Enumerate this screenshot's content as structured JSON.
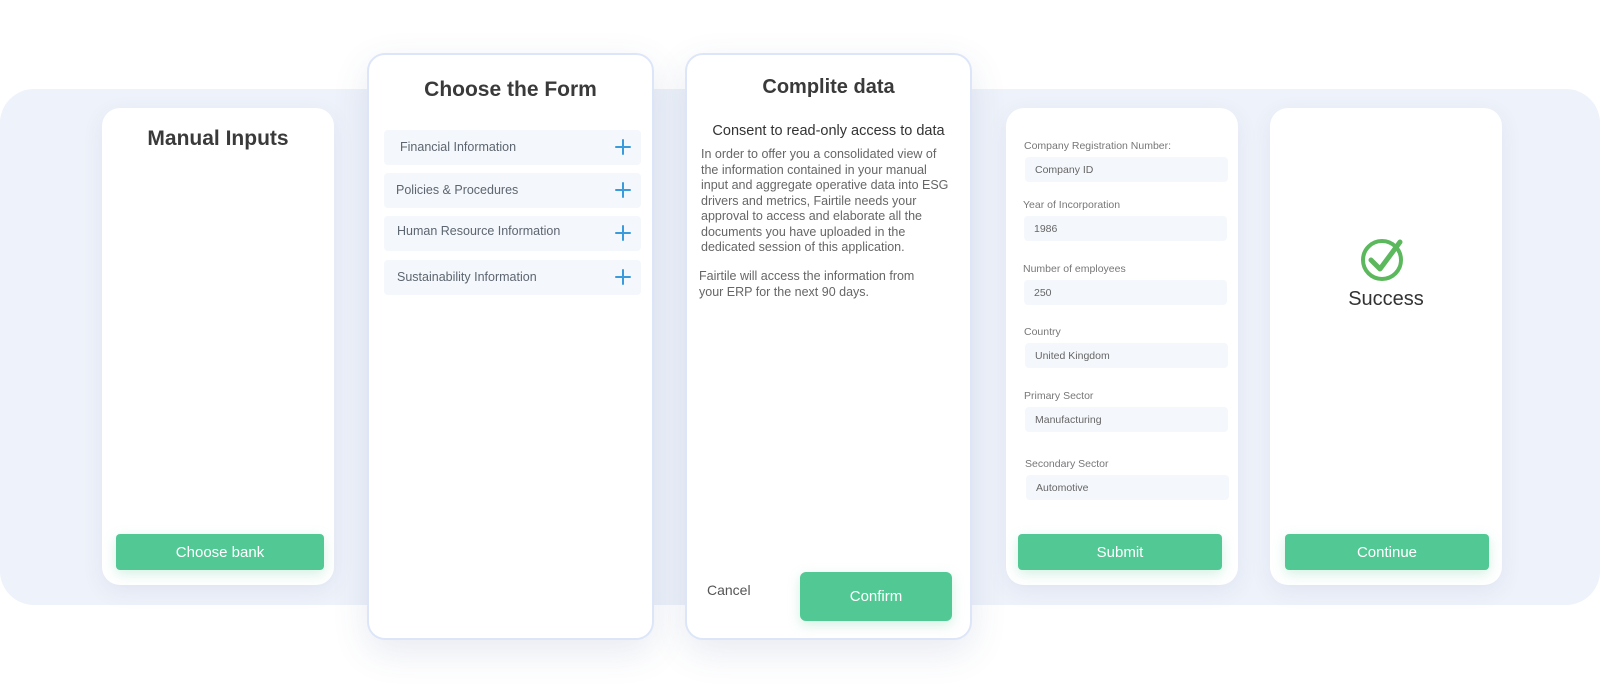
{
  "colors": {
    "accent_green": "#52c994",
    "plus_blue": "#3a9bdc",
    "success_green": "#5cb85c",
    "band_bg": "#eef2fa"
  },
  "manual_inputs": {
    "title": "Manual Inputs",
    "button_label": "Choose bank"
  },
  "choose_form": {
    "title": "Choose the Form",
    "items": [
      {
        "label": "Financial Information",
        "icon": "plus-icon"
      },
      {
        "label": "Policies & Procedures",
        "icon": "plus-icon"
      },
      {
        "label": "Human Resource Information",
        "icon": "plus-icon"
      },
      {
        "label": "Sustainability Information",
        "icon": "plus-icon"
      }
    ]
  },
  "complete_data": {
    "title": "Complite data",
    "subtitle": "Consent to read-only access to data",
    "paragraph_lines": [
      "In order to offer you a consolidated view of",
      "the information contained in your manual",
      "input and aggregate operative data into ESG",
      "drivers and metrics, Fairtile needs your",
      "approval to access and elaborate all the",
      "documents you have uploaded in the",
      "dedicated session of this application."
    ],
    "paragraph2_lines": [
      "Fairtile will access the information from",
      "your ERP for the next 90 days."
    ],
    "cancel_label": "Cancel",
    "confirm_label": "Confirm"
  },
  "company_form": {
    "fields": [
      {
        "label": "Company Registration Number:",
        "value": "Company ID"
      },
      {
        "label": "Year of Incorporation",
        "value": "1986"
      },
      {
        "label": "Number of employees",
        "value": "250"
      },
      {
        "label": "Country",
        "value": "United Kingdom"
      },
      {
        "label": "Primary Sector",
        "value": "Manufacturing"
      },
      {
        "label": "Secondary Sector",
        "value": "Automotive"
      }
    ],
    "submit_label": "Submit"
  },
  "success": {
    "icon": "check-circle-icon",
    "label": "Success",
    "button_label": "Continue"
  }
}
